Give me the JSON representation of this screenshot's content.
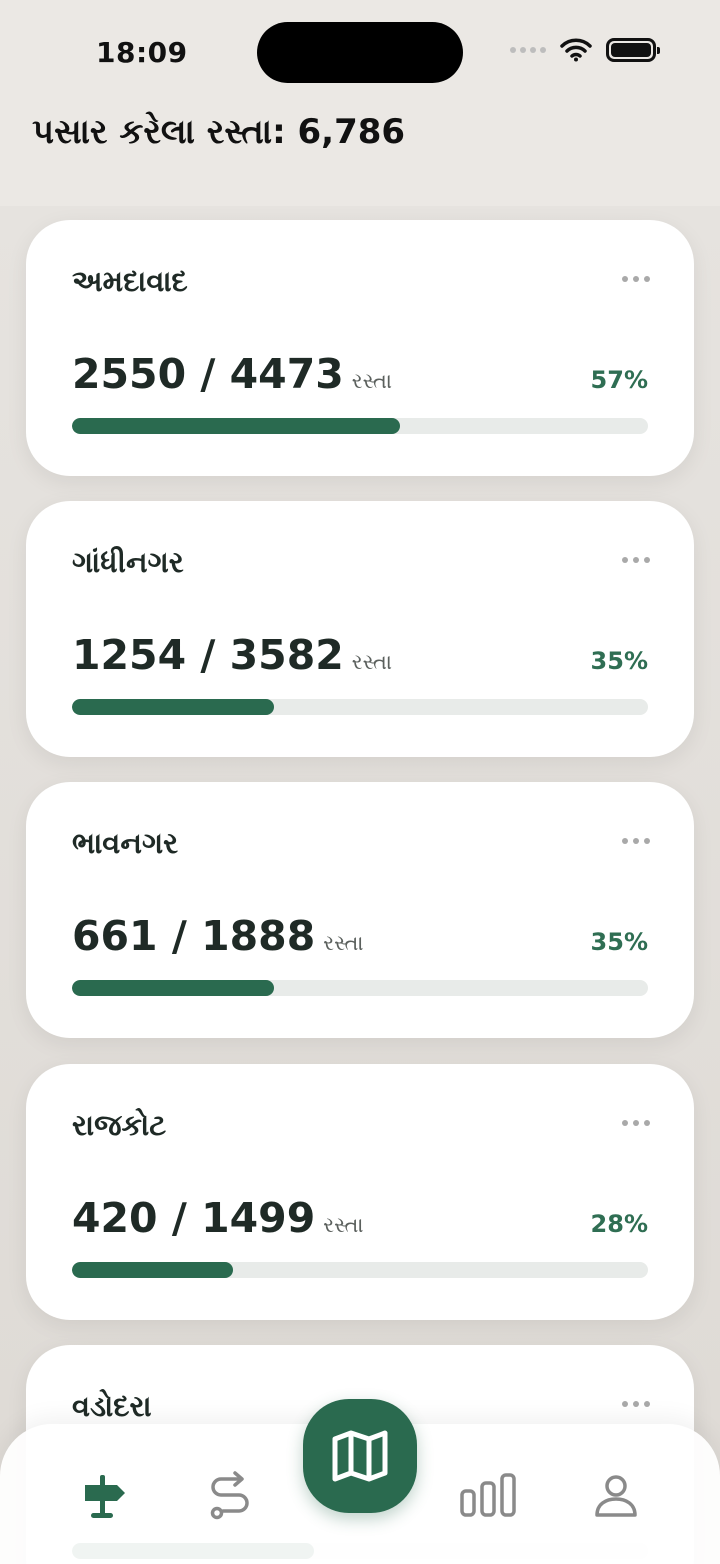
{
  "status_bar": {
    "time": "18:09"
  },
  "header": {
    "title": "પસાર કરેલા રસ્તા: 6,786"
  },
  "cities": [
    {
      "name": "અમદાવાદ",
      "count": "2550 / 4473",
      "unit": "રસ્તા",
      "percent_label": "57%",
      "progress": 0.57
    },
    {
      "name": "ગાંધીનગર",
      "count": "1254 / 3582",
      "unit": "રસ્તા",
      "percent_label": "35%",
      "progress": 0.35
    },
    {
      "name": "ભાવનગર",
      "count": "661 / 1888",
      "unit": "રસ્તા",
      "percent_label": "35%",
      "progress": 0.35
    },
    {
      "name": "રાજકોટ",
      "count": "420 / 1499",
      "unit": "રસ્તા",
      "percent_label": "28%",
      "progress": 0.28
    },
    {
      "name": "વડોદરા",
      "count": "",
      "unit": "",
      "percent_label": "",
      "progress": 0.42
    }
  ],
  "tab_bar": {
    "items": [
      {
        "icon": "signpost-icon",
        "active": true
      },
      {
        "icon": "route-icon",
        "active": false
      },
      {
        "icon": "map-icon",
        "active": false
      },
      {
        "icon": "stats-icon",
        "active": false
      },
      {
        "icon": "profile-icon",
        "active": false
      }
    ]
  },
  "colors": {
    "accent": "#2a6a4f",
    "percent_text": "#2f6e53",
    "track": "#e8ebe9",
    "background": "#ebe8e4",
    "icon_inactive": "#8a8a8a"
  }
}
